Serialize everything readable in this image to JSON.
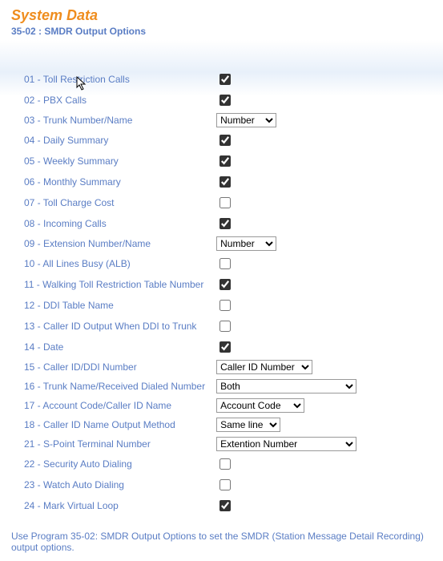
{
  "header": {
    "title": "System Data",
    "subtitle": "35-02 : SMDR Output Options"
  },
  "rows": [
    {
      "label": "01 - Toll Restriction Calls",
      "control": "checkbox",
      "checked": true
    },
    {
      "label": "02 - PBX Calls",
      "control": "checkbox",
      "checked": true
    },
    {
      "label": "03 - Trunk Number/Name",
      "control": "select",
      "value": "Number"
    },
    {
      "label": "04 - Daily Summary",
      "control": "checkbox",
      "checked": true
    },
    {
      "label": "05 - Weekly Summary",
      "control": "checkbox",
      "checked": true
    },
    {
      "label": "06 - Monthly Summary",
      "control": "checkbox",
      "checked": true
    },
    {
      "label": "07 - Toll Charge Cost",
      "control": "checkbox",
      "checked": false
    },
    {
      "label": "08 - Incoming Calls",
      "control": "checkbox",
      "checked": true
    },
    {
      "label": "09 - Extension Number/Name",
      "control": "select",
      "value": "Number"
    },
    {
      "label": "10 - All Lines Busy (ALB)",
      "control": "checkbox",
      "checked": false
    },
    {
      "label": "11 - Walking Toll Restriction Table Number",
      "control": "checkbox",
      "checked": true
    },
    {
      "label": "12 - DDI Table Name",
      "control": "checkbox",
      "checked": false
    },
    {
      "label": "13 - Caller ID Output When DDI to Trunk",
      "control": "checkbox",
      "checked": false
    },
    {
      "label": "14 - Date",
      "control": "checkbox",
      "checked": true
    },
    {
      "label": "15 - Caller ID/DDI Number",
      "control": "select",
      "value": "Caller ID Number"
    },
    {
      "label": "16 - Trunk Name/Received Dialed Number",
      "control": "select",
      "value": "Both"
    },
    {
      "label": "17 - Account Code/Caller ID Name",
      "control": "select",
      "value": "Account Code"
    },
    {
      "label": "18 - Caller ID Name Output Method",
      "control": "select",
      "value": "Same line"
    },
    {
      "label": "21 - S-Point Terminal Number",
      "control": "select",
      "value": "Extention Number"
    },
    {
      "label": "22 - Security Auto Dialing",
      "control": "checkbox",
      "checked": false
    },
    {
      "label": "23 - Watch Auto Dialing",
      "control": "checkbox",
      "checked": false
    },
    {
      "label": "24 - Mark Virtual Loop",
      "control": "checkbox",
      "checked": true
    }
  ],
  "select_widths": {
    "3": "75px",
    "9": "75px",
    "15": "120px",
    "16": "175px",
    "17": "110px",
    "18": "80px",
    "21": "175px"
  },
  "footnote": "Use Program 35-02: SMDR Output Options to set the SMDR (Station Message Detail Recording) output options."
}
